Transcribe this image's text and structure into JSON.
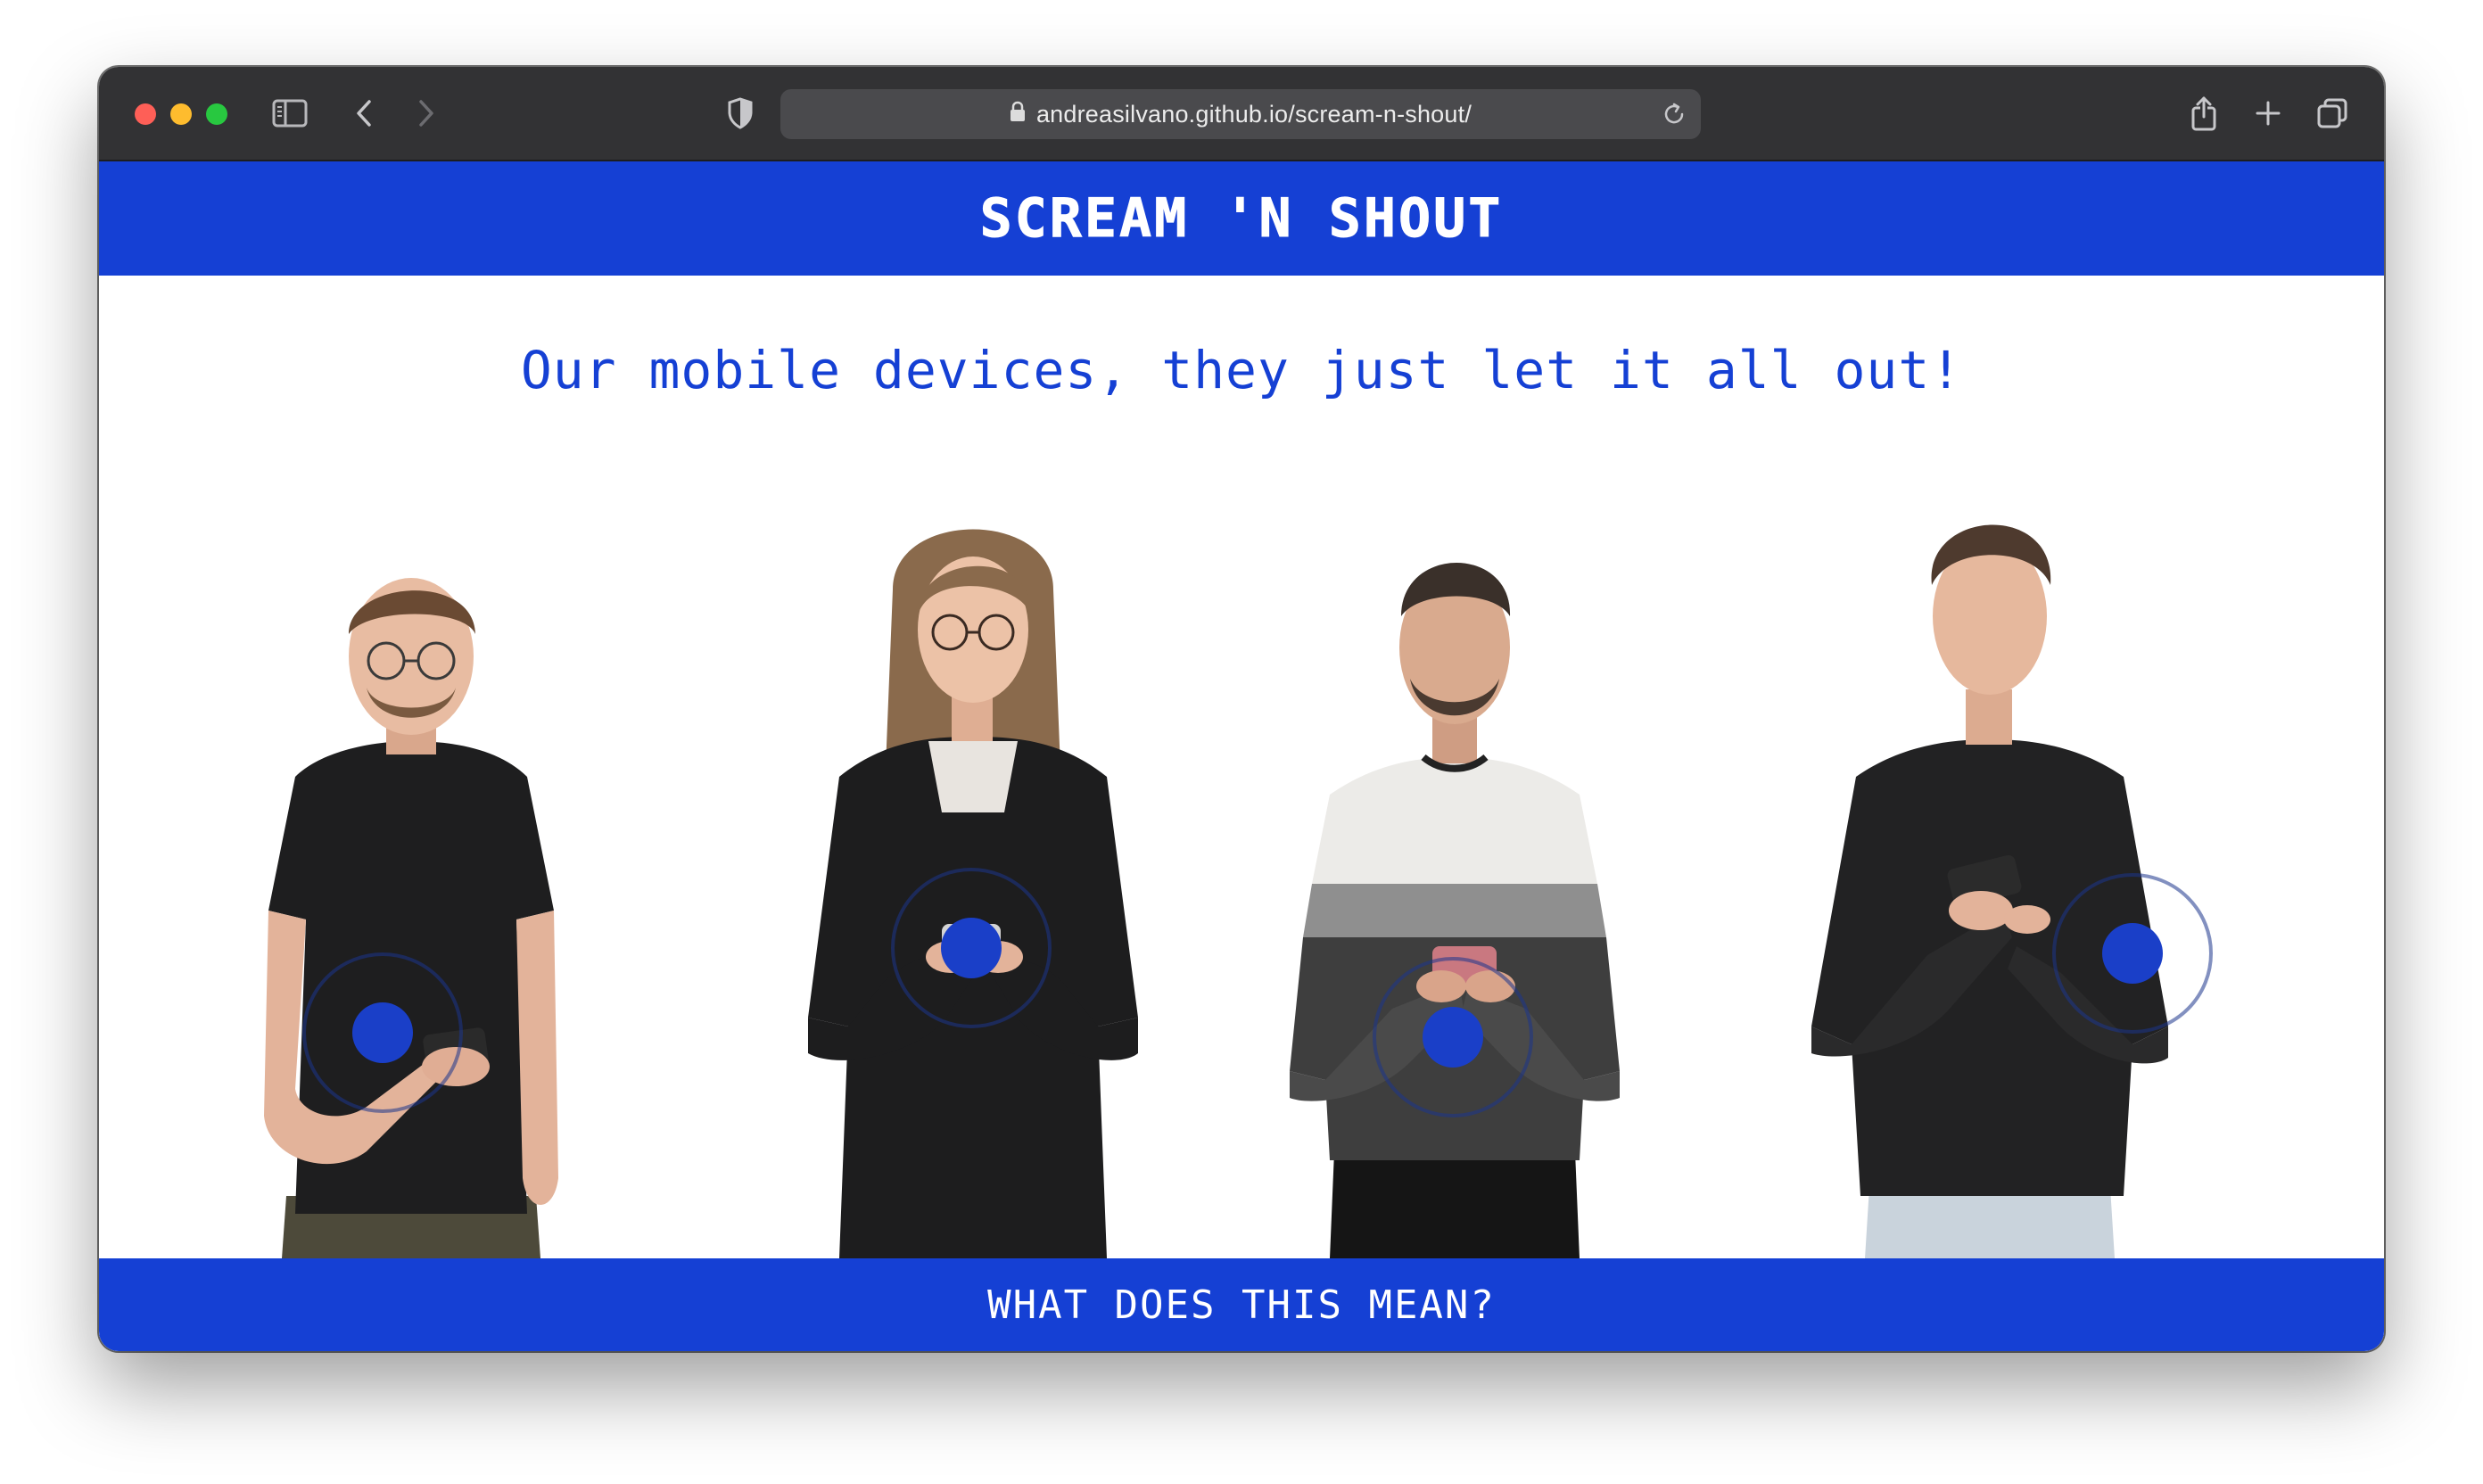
{
  "browser": {
    "url": "andreasilvano.github.io/scream-n-shout/",
    "icons": {
      "sidebar": "sidebar-icon",
      "back": "chevron-left-icon",
      "forward": "chevron-right-icon",
      "privacy": "shield-icon",
      "lock": "lock-icon",
      "reload": "reload-icon",
      "share": "share-icon",
      "new_tab": "plus-icon",
      "tabs": "tabs-overview-icon"
    }
  },
  "site": {
    "title": "SCREAM 'N SHOUT",
    "tagline": "Our mobile devices, they just let it all out!",
    "cta": "WHAT DOES THIS MEAN?",
    "accent_color": "#1540d4"
  },
  "people": [
    {
      "label": "person-1"
    },
    {
      "label": "person-2"
    },
    {
      "label": "person-3"
    },
    {
      "label": "person-4"
    }
  ]
}
